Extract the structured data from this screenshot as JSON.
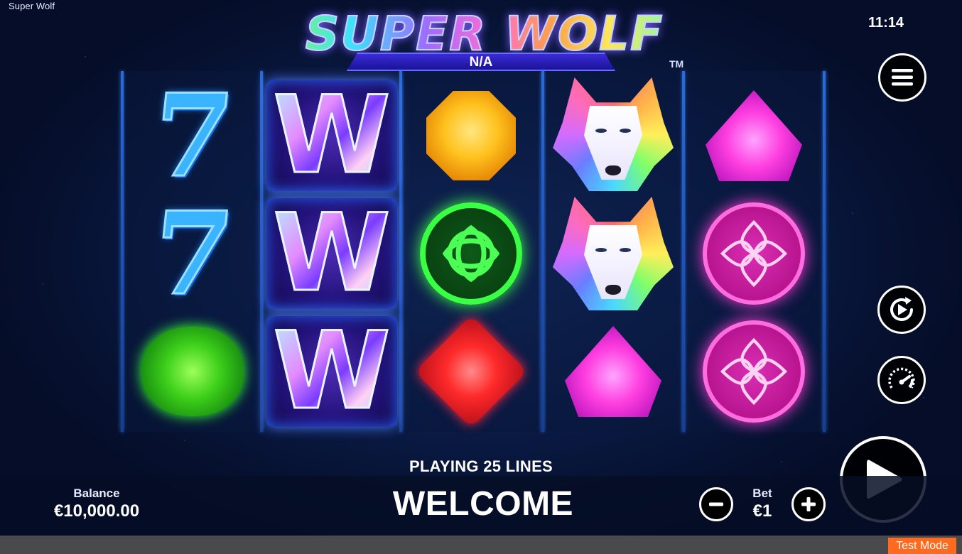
{
  "window": {
    "title": "Super Wolf"
  },
  "status": {
    "clock": "11:14"
  },
  "logo": {
    "title": "SUPER WOLF",
    "subtitle": "N/A",
    "trademark": "TM"
  },
  "reels": [
    [
      "seven-symbol",
      "seven-symbol",
      "green-gem-symbol"
    ],
    [
      "wild-w-symbol",
      "wild-w-symbol",
      "wild-w-symbol"
    ],
    [
      "yellow-octagon-gem-symbol",
      "green-knot-symbol",
      "red-diamond-gem-symbol"
    ],
    [
      "wolf-symbol",
      "wolf-symbol",
      "pink-gem-symbol"
    ],
    [
      "pink-gem-symbol",
      "pink-knot-symbol",
      "pink-knot-symbol"
    ]
  ],
  "symbols": {
    "seven": "7",
    "wild": "W"
  },
  "controls": {
    "menu_icon": "hamburger-icon",
    "autoplay_icon": "autoplay-icon",
    "speed_icon": "speedometer-icon",
    "spin_icon": "play-icon"
  },
  "info": {
    "lines": "PLAYING 25 LINES",
    "message": "WELCOME"
  },
  "balance": {
    "label": "Balance",
    "value": "€10,000.00"
  },
  "bet": {
    "label": "Bet",
    "value": "€1",
    "decrease_icon": "minus-icon",
    "increase_icon": "plus-icon"
  },
  "footer": {
    "mode": "Test Mode"
  },
  "colors": {
    "background": "#0c1f4e",
    "reel_divider": "#2a6bd6",
    "test_mode": "#ff6a1f",
    "footer_strip": "#4a4a4c"
  }
}
